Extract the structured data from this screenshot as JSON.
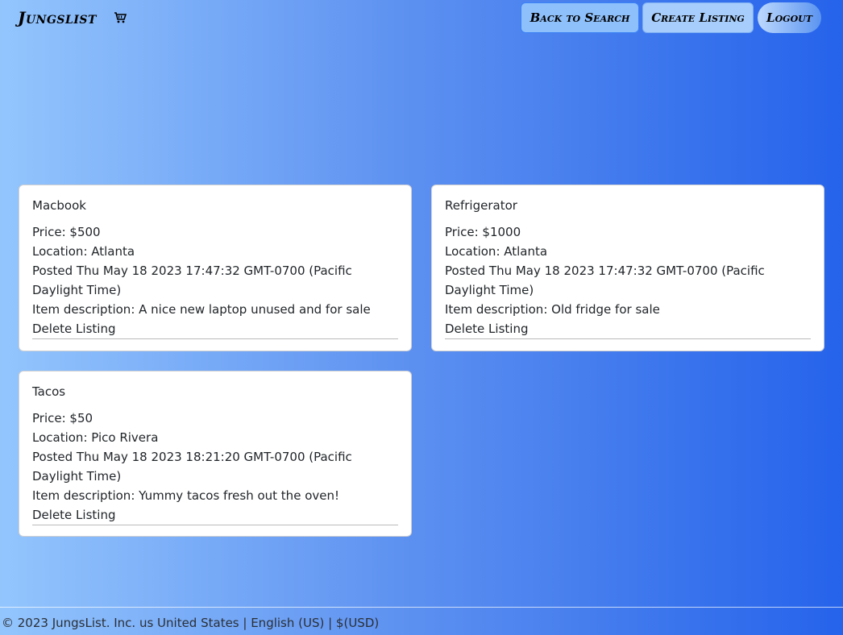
{
  "navbar": {
    "brand": "Jungslist",
    "cart_icon": "cart-icon",
    "buttons": {
      "back": "Back to Search",
      "create": "Create Listing",
      "logout": "Logout"
    }
  },
  "listings": [
    {
      "title": "Macbook",
      "price": "Price: $500",
      "location": "Location: Atlanta",
      "posted": "Posted Thu May 18 2023 17:47:32 GMT-0700 (Pacific Daylight Time)",
      "description": "Item description: A nice new laptop unused and for sale",
      "delete_label": "Delete Listing"
    },
    {
      "title": "Refrigerator",
      "price": "Price: $1000",
      "location": "Location: Atlanta",
      "posted": "Posted Thu May 18 2023 17:47:32 GMT-0700 (Pacific Daylight Time)",
      "description": "Item description: Old fridge for sale",
      "delete_label": "Delete Listing"
    },
    {
      "title": "Tacos",
      "price": "Price: $50",
      "location": "Location: Pico Rivera",
      "posted": "Posted Thu May 18 2023 18:21:20 GMT-0700 (Pacific Daylight Time)",
      "description": "Item description: Yummy tacos fresh out the oven!",
      "delete_label": "Delete Listing"
    }
  ],
  "footer": {
    "text": "© 2023 JungsList. Inc. us United States | English (US) | $(USD)"
  },
  "colors": {
    "gradient_start": "#93c5fd",
    "gradient_end": "#2563eb",
    "card_bg": "#ffffff"
  }
}
